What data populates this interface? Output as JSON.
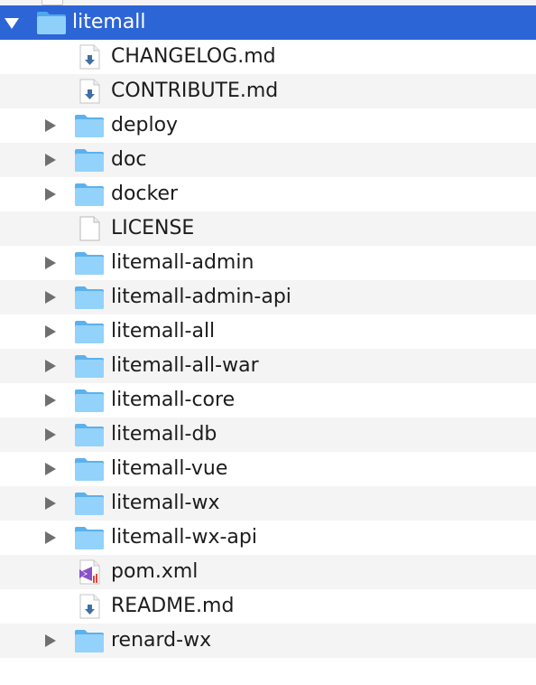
{
  "root": {
    "name": "litemall",
    "expanded": true,
    "selected": true,
    "icon": "folder-icon"
  },
  "items": [
    {
      "name": "CHANGELOG.md",
      "kind": "file",
      "icon": "markdown-file-icon"
    },
    {
      "name": "CONTRIBUTE.md",
      "kind": "file",
      "icon": "markdown-file-icon"
    },
    {
      "name": "deploy",
      "kind": "folder",
      "icon": "folder-icon"
    },
    {
      "name": "doc",
      "kind": "folder",
      "icon": "folder-icon"
    },
    {
      "name": "docker",
      "kind": "folder",
      "icon": "folder-icon"
    },
    {
      "name": "LICENSE",
      "kind": "file",
      "icon": "document-icon"
    },
    {
      "name": "litemall-admin",
      "kind": "folder",
      "icon": "folder-icon"
    },
    {
      "name": "litemall-admin-api",
      "kind": "folder",
      "icon": "folder-icon"
    },
    {
      "name": "litemall-all",
      "kind": "folder",
      "icon": "folder-icon"
    },
    {
      "name": "litemall-all-war",
      "kind": "folder",
      "icon": "folder-icon"
    },
    {
      "name": "litemall-core",
      "kind": "folder",
      "icon": "folder-icon"
    },
    {
      "name": "litemall-db",
      "kind": "folder",
      "icon": "folder-icon"
    },
    {
      "name": "litemall-vue",
      "kind": "folder",
      "icon": "folder-icon"
    },
    {
      "name": "litemall-wx",
      "kind": "folder",
      "icon": "folder-icon"
    },
    {
      "name": "litemall-wx-api",
      "kind": "folder",
      "icon": "folder-icon"
    },
    {
      "name": "pom.xml",
      "kind": "file",
      "icon": "visual-studio-file-icon"
    },
    {
      "name": "README.md",
      "kind": "file",
      "icon": "markdown-file-icon"
    },
    {
      "name": "renard-wx",
      "kind": "folder",
      "icon": "folder-icon"
    }
  ],
  "colors": {
    "selection": "#2c65d6",
    "stripe": "#f4f4f4",
    "folder": "#7cc8f5"
  }
}
